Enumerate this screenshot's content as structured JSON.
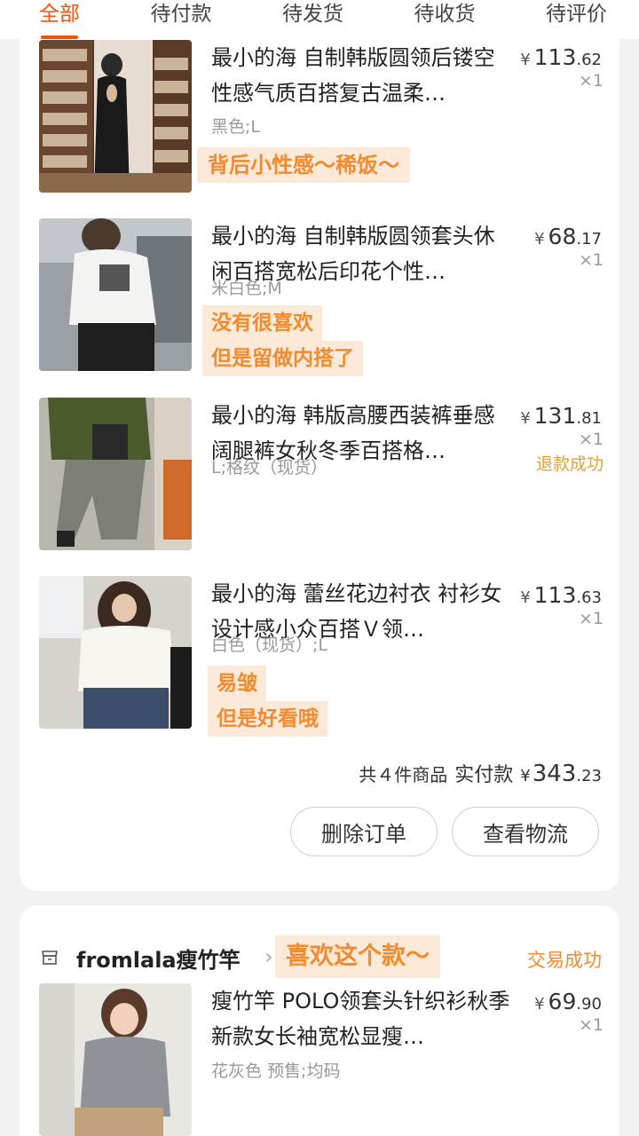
{
  "tabs": [
    {
      "label": "全部",
      "active": true
    },
    {
      "label": "待付款"
    },
    {
      "label": "待发货"
    },
    {
      "label": "待收货"
    },
    {
      "label": "待评价"
    }
  ],
  "order1": {
    "items": [
      {
        "title": "最小的海 自制韩版圆领后镂空性感气质百搭复古温柔…",
        "spec": "黑色;L",
        "price_int": "113",
        "price_dec": ".62",
        "currency": "¥",
        "qty": "×1",
        "note": "背后小性感～稀饭～"
      },
      {
        "title": "最小的海 自制韩版圆领套头休闲百搭宽松后印花个性…",
        "spec": "米白色;M",
        "price_int": "68",
        "price_dec": ".17",
        "currency": "¥",
        "qty": "×1",
        "note_lines": [
          "没有很喜欢",
          "但是留做内搭了"
        ]
      },
      {
        "title": "最小的海 韩版高腰西装裤垂感阔腿裤女秋冬季百搭格…",
        "spec": "L;格纹（现货）",
        "price_int": "131",
        "price_dec": ".81",
        "currency": "¥",
        "qty": "×1",
        "status": "退款成功"
      },
      {
        "title": "最小的海 蕾丝花边衬衣 衬衫女设计感小众百搭Ｖ领…",
        "spec": "白色（现货）;L",
        "price_int": "113",
        "price_dec": ".63",
        "currency": "¥",
        "qty": "×1",
        "note_lines": [
          "易皱",
          "但是好看哦"
        ]
      }
    ],
    "summary": {
      "count_label": "共４件商品",
      "paid_label": "实付款",
      "currency": "¥",
      "total_int": "343",
      "total_dec": ".23"
    },
    "buttons": {
      "delete": "删除订单",
      "logistics": "查看物流"
    }
  },
  "order2": {
    "store_name": "fromlala瘦竹竿",
    "store_chevron": "›",
    "note": "喜欢这个款～",
    "status": "交易成功",
    "items": [
      {
        "title": "瘦竹竿 POLO领套头针织衫秋季新款女长袖宽松显瘦…",
        "spec": "花灰色 预售;均码",
        "price_int": "69",
        "price_dec": ".90",
        "currency": "¥",
        "qty": "×1"
      }
    ]
  }
}
